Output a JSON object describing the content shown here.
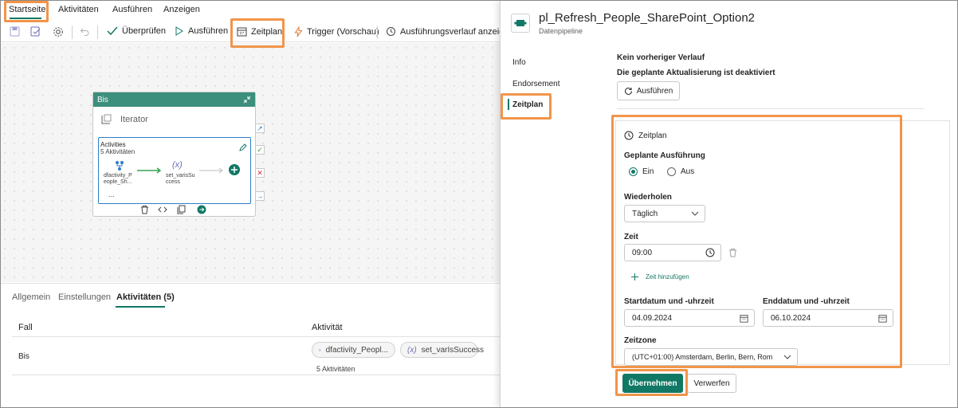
{
  "menu": {
    "tabs": [
      "Startseite",
      "Aktivitäten",
      "Ausführen",
      "Anzeigen"
    ]
  },
  "toolbar": {
    "validate": "Überprüfen",
    "run": "Ausführen",
    "schedule": "Zeitplan",
    "trigger": "Trigger (Vorschau)",
    "history": "Ausführungsverlauf anzeigen"
  },
  "canvas": {
    "card_title": "Bis",
    "iterator_label": "Iterator",
    "activities_label": "Activities",
    "activities_count": "5 Aktivitäten",
    "node1_label": "dfactivity_P eople_Sh...",
    "node2_label": "set_varisSu ccess",
    "node2_symbol": "(x)",
    "more": "..."
  },
  "bottom": {
    "tabs": [
      "Allgemein",
      "Einstellungen",
      "Aktivitäten (5)"
    ],
    "col_case": "Fall",
    "col_activity": "Aktivität",
    "row_case": "Bis",
    "pill1": "dfactivity_Peopl...",
    "pill2": "set_varIsSuccess",
    "pill2_symbol": "(x)",
    "row_count": "5 Aktivitäten"
  },
  "panel": {
    "title": "pl_Refresh_People_SharePoint_Option2",
    "subtitle": "Datenpipeline",
    "nav": [
      "Info",
      "Endorsement",
      "Zeitplan"
    ],
    "no_history": "Kein vorheriger Verlauf",
    "refresh_disabled": "Die geplante Aktualisierung ist deaktiviert",
    "run_button": "Ausführen",
    "schedule_header": "Zeitplan",
    "scheduled_run_label": "Geplante Ausführung",
    "radio_on": "Ein",
    "radio_off": "Aus",
    "repeat_label": "Wiederholen",
    "repeat_value": "Täglich",
    "time_label": "Zeit",
    "time_value": "09:00",
    "add_time": "Zeit hinzufügen",
    "start_label": "Startdatum und -uhrzeit",
    "start_value": "04.09.2024",
    "end_label": "Enddatum und -uhrzeit",
    "end_value": "06.10.2024",
    "timezone_label": "Zeitzone",
    "timezone_value": "(UTC+01:00) Amsterdam, Berlin, Bern, Rom",
    "apply": "Übernehmen",
    "discard": "Verwerfen"
  },
  "colors": {
    "accent": "#117865",
    "highlight": "#f0954a",
    "card_header": "#3c8f7c"
  }
}
